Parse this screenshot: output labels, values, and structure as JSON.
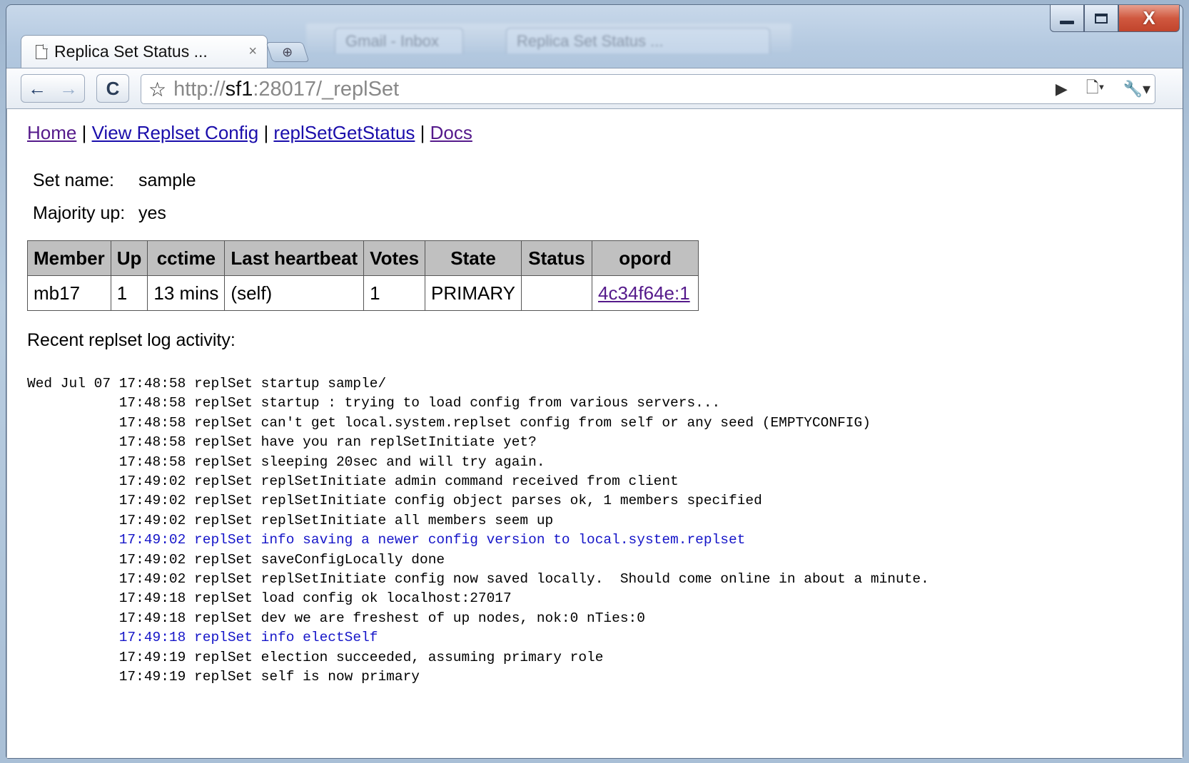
{
  "window": {
    "controls": {
      "close_glyph": "X"
    }
  },
  "tab": {
    "title": "Replica Set Status ...",
    "close_glyph": "×",
    "new_tab_glyph": "⊕",
    "ghost_tabs": [
      "Gmail - Inbox",
      "Replica Set Status ..."
    ]
  },
  "toolbar": {
    "back_glyph": "←",
    "forward_glyph": "→",
    "reload_glyph": "C",
    "star_glyph": "☆",
    "url_prefix": "http://",
    "url_host": "sf1",
    "url_rest": ":28017/_replSet",
    "go_glyph": "▶",
    "page_menu_glyph": "🗋▾",
    "wrench_menu_glyph": "🔧▾"
  },
  "nav": {
    "links": [
      "Home",
      "View Replset Config",
      "replSetGetStatus",
      "Docs"
    ],
    "separator": " | "
  },
  "set_info": {
    "name_label": "Set name:",
    "name_value": "sample",
    "majority_label": "Majority up:",
    "majority_value": "yes"
  },
  "members_table": {
    "headers": [
      "Member",
      "Up",
      "cctime",
      "Last heartbeat",
      "Votes",
      "State",
      "Status",
      "opord"
    ],
    "rows": [
      [
        "mb17",
        "1",
        "13 mins",
        "(self)",
        "1",
        "PRIMARY",
        "",
        "4c34f64e:1"
      ]
    ]
  },
  "log": {
    "title": "Recent replset log activity:",
    "lines": [
      {
        "text": "Wed Jul 07 17:48:58 replSet startup sample/",
        "level": "normal"
      },
      {
        "text": "           17:48:58 replSet startup : trying to load config from various servers...",
        "level": "normal"
      },
      {
        "text": "           17:48:58 replSet can't get local.system.replset config from self or any seed (EMPTYCONFIG)",
        "level": "normal"
      },
      {
        "text": "           17:48:58 replSet have you ran replSetInitiate yet?",
        "level": "normal"
      },
      {
        "text": "           17:48:58 replSet sleeping 20sec and will try again.",
        "level": "normal"
      },
      {
        "text": "           17:49:02 replSet replSetInitiate admin command received from client",
        "level": "normal"
      },
      {
        "text": "           17:49:02 replSet replSetInitiate config object parses ok, 1 members specified",
        "level": "normal"
      },
      {
        "text": "           17:49:02 replSet replSetInitiate all members seem up",
        "level": "normal"
      },
      {
        "text": "           17:49:02 replSet info saving a newer config version to local.system.replset",
        "level": "info"
      },
      {
        "text": "           17:49:02 replSet saveConfigLocally done",
        "level": "normal"
      },
      {
        "text": "           17:49:02 replSet replSetInitiate config now saved locally.  Should come online in about a minute.",
        "level": "normal"
      },
      {
        "text": "           17:49:18 replSet load config ok localhost:27017",
        "level": "normal"
      },
      {
        "text": "           17:49:18 replSet dev we are freshest of up nodes, nok:0 nTies:0",
        "level": "normal"
      },
      {
        "text": "           17:49:18 replSet info electSelf",
        "level": "info"
      },
      {
        "text": "           17:49:19 replSet election succeeded, assuming primary role",
        "level": "normal"
      },
      {
        "text": "           17:49:19 replSet self is now primary",
        "level": "normal"
      }
    ]
  },
  "colors": {
    "visited_link": "#551a8b",
    "link": "#1a0dab",
    "info_log": "#1515c8",
    "table_header_bg": "#c0c0c0",
    "close_button": "#c1442c"
  }
}
